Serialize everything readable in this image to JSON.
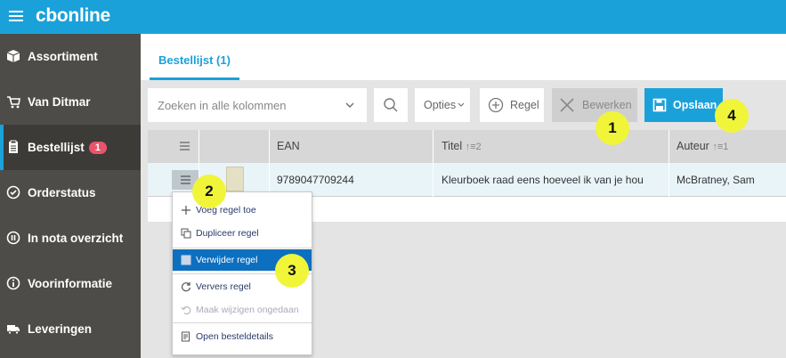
{
  "app": {
    "logo": "cbonline"
  },
  "sidebar": {
    "items": [
      {
        "label": "Assortiment",
        "icon": "box-icon"
      },
      {
        "label": "Van Ditmar",
        "icon": "cart-icon"
      },
      {
        "label": "Bestellijst",
        "icon": "clipboard-icon",
        "badge": "1",
        "active": true
      },
      {
        "label": "Orderstatus",
        "icon": "check-circle-icon"
      },
      {
        "label": "In nota overzicht",
        "icon": "pause-circle-icon"
      },
      {
        "label": "Voorinformatie",
        "icon": "info-circle-icon"
      },
      {
        "label": "Leveringen",
        "icon": "truck-icon"
      }
    ]
  },
  "tabs": [
    {
      "label": "Bestellijst (1)",
      "active": true
    }
  ],
  "toolbar": {
    "search_placeholder": "Zoeken in alle kolommen",
    "opties_label": "Opties",
    "regel_label": "Regel",
    "bewerken_label": "Bewerken",
    "opslaan_label": "Opslaan"
  },
  "table": {
    "headers": {
      "ean": "EAN",
      "titel": "Titel",
      "titel_sort": "↑≡2",
      "auteur": "Auteur",
      "auteur_sort": "↑≡1"
    },
    "rows": [
      {
        "ean": "9789047709244",
        "titel": "Kleurboek raad eens hoeveel ik van je hou",
        "auteur": "McBratney, Sam"
      }
    ]
  },
  "context_menu": {
    "items": [
      {
        "label": "Voeg regel toe",
        "icon": "plus-icon"
      },
      {
        "label": "Dupliceer regel",
        "icon": "copy-icon"
      },
      {
        "label": "Verwijder regel",
        "icon": "trash-icon",
        "selected": true
      },
      {
        "label": "Ververs regel",
        "icon": "refresh-icon"
      },
      {
        "label": "Maak wijzigen ongedaan",
        "icon": "undo-icon",
        "disabled": true
      },
      {
        "label": "Open besteldetails",
        "icon": "details-icon"
      }
    ]
  },
  "callouts": {
    "c1": "1",
    "c2": "2",
    "c3": "3",
    "c4": "4"
  },
  "colors": {
    "brand": "#1ba1d9",
    "sidebar": "#4d4c48",
    "badge": "#e8546b",
    "highlight": "#f0f53a",
    "menu_selected": "#0d6fc0"
  }
}
